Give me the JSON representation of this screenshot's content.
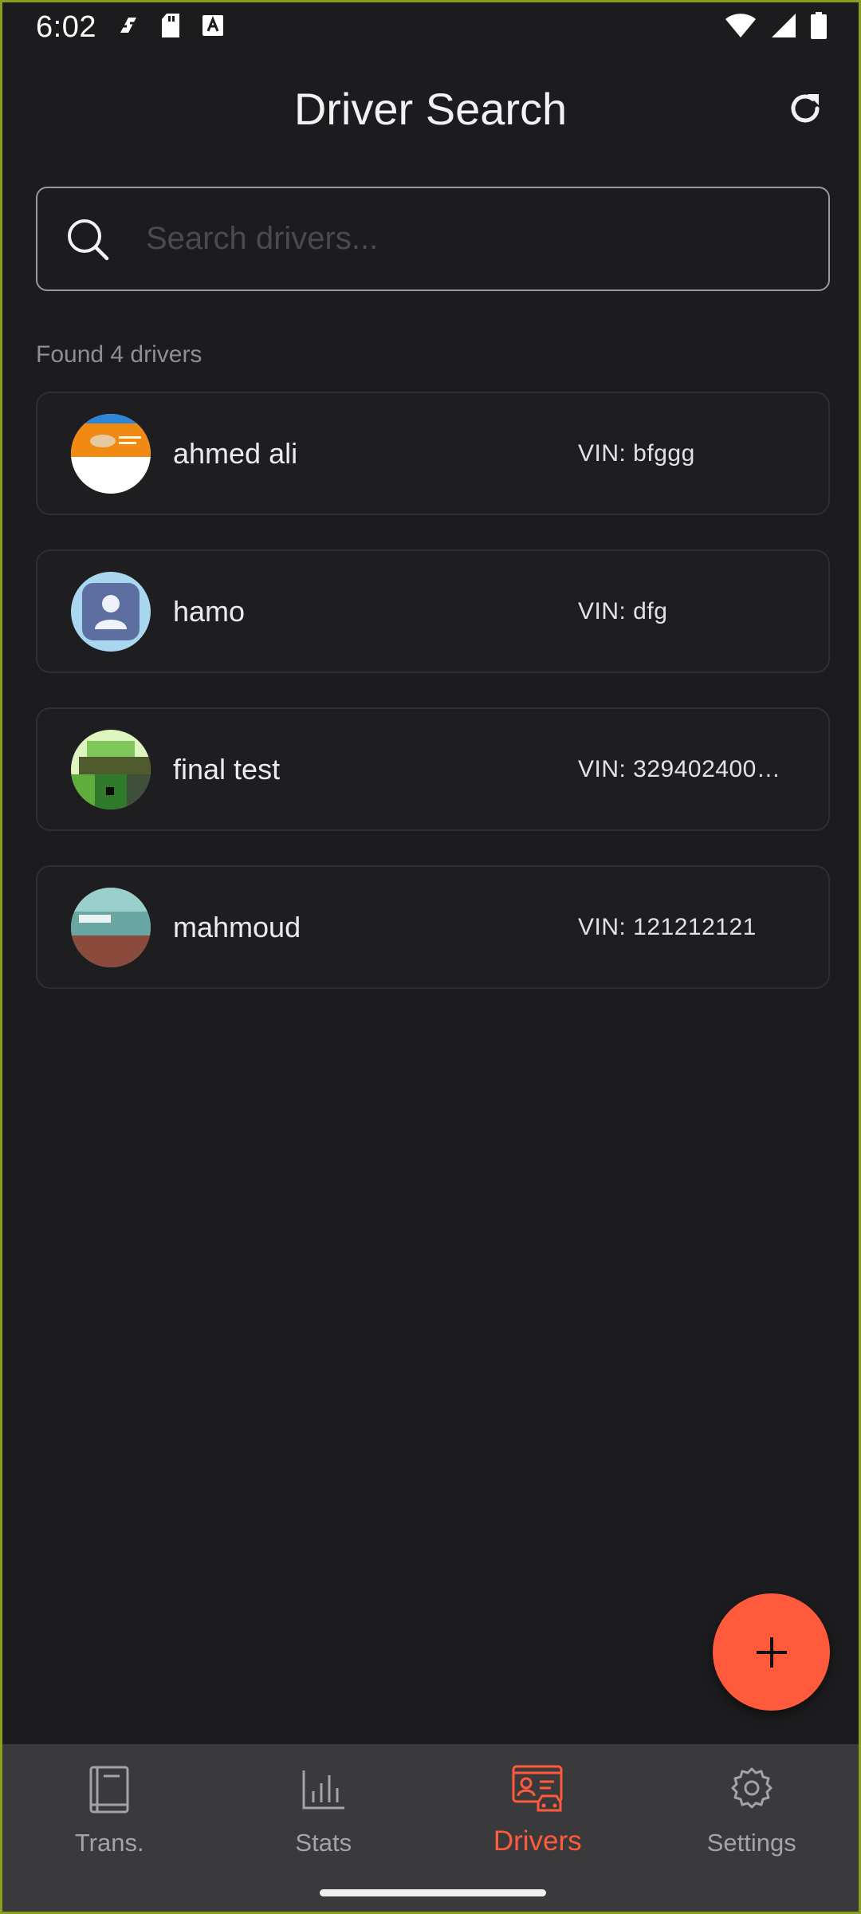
{
  "status_bar": {
    "time": "6:02",
    "icons_left": [
      "shield-sync-icon",
      "sd-card-icon",
      "font-a-icon"
    ],
    "icons_right": [
      "wifi-icon",
      "cellular-signal-icon",
      "battery-icon"
    ]
  },
  "header": {
    "title": "Driver Search",
    "refresh_icon": "refresh-icon"
  },
  "search": {
    "placeholder": "Search drivers...",
    "value": ""
  },
  "results": {
    "count_text": "Found 4 drivers"
  },
  "drivers": [
    {
      "name": "ahmed ali",
      "vin": "VIN: bfggg",
      "avatar": "photo-orange-banner"
    },
    {
      "name": "hamo",
      "vin": "VIN: dfg",
      "avatar": "default-person"
    },
    {
      "name": "final test",
      "vin": "VIN: 329402400…",
      "avatar": "photo-pixel-green"
    },
    {
      "name": "mahmoud",
      "vin": "VIN: 121212121",
      "avatar": "photo-teal-cloth"
    }
  ],
  "fab": {
    "icon": "plus-icon"
  },
  "bottom_nav": {
    "active": "Drivers",
    "items": [
      {
        "label": "Trans.",
        "icon": "book-icon"
      },
      {
        "label": "Stats",
        "icon": "bar-chart-icon"
      },
      {
        "label": "Drivers",
        "icon": "driver-card-icon"
      },
      {
        "label": "Settings",
        "icon": "gear-icon"
      }
    ]
  },
  "colors": {
    "background": "#1c1c1e",
    "accent": "#ff5a3c",
    "nav_background": "#3a3a3c",
    "card_border": "#2f2f33",
    "muted_text": "#8e8e93"
  }
}
